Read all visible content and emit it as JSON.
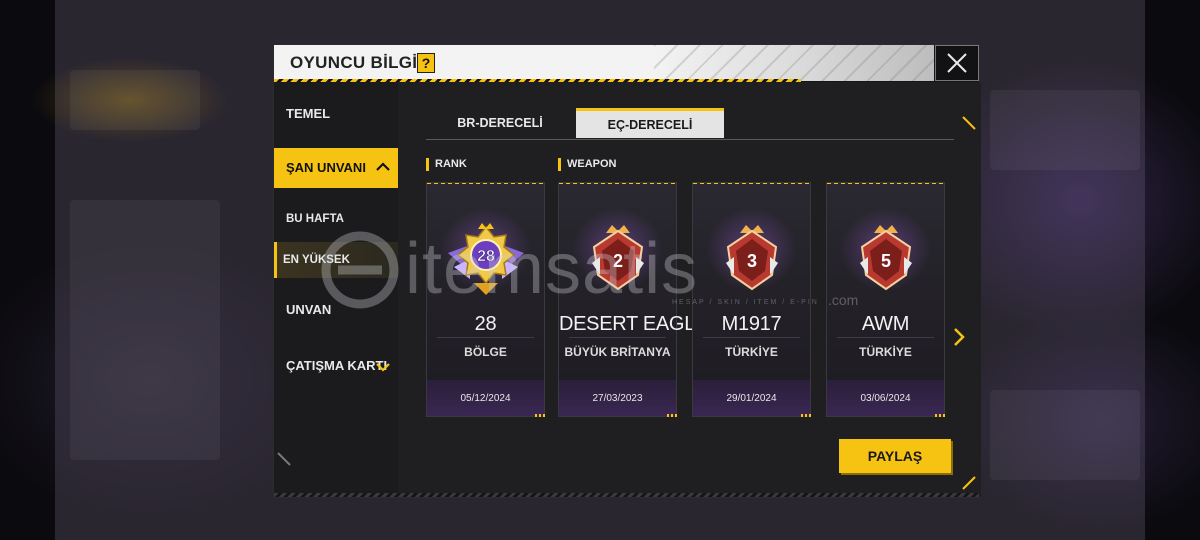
{
  "dialog": {
    "title": "OYUNCU BİLGİSİ",
    "help_icon": "?",
    "close_icon": "close-icon"
  },
  "sidebar": {
    "items": [
      {
        "label": "TEMEL",
        "type": "main"
      },
      {
        "label": "ŞAN UNVANI",
        "type": "main",
        "active": true,
        "icon": "chevron-up-icon"
      },
      {
        "label": "BU HAFTA",
        "type": "sub"
      },
      {
        "label": "EN YÜKSEK",
        "type": "sub",
        "selected": true
      },
      {
        "label": "UNVAN",
        "type": "main"
      },
      {
        "label": "ÇATIŞMA KARTI",
        "type": "main",
        "icon": "chevron-down-icon"
      }
    ]
  },
  "tabs": [
    {
      "label": "BR-DERECELİ",
      "active": false
    },
    {
      "label": "EÇ-DERECELİ",
      "active": true
    }
  ],
  "sections": {
    "rank": "RANK",
    "weapon": "WEAPON"
  },
  "cards": [
    {
      "badge_number": "28",
      "name": "28",
      "region": "BÖLGE",
      "date": "05/12/2024"
    },
    {
      "badge_number": "2",
      "name": "DESERT EAGLE",
      "region": "BÜYÜK BRİTANYA",
      "date": "27/03/2023"
    },
    {
      "badge_number": "3",
      "name": "M1917",
      "region": "TÜRKİYE",
      "date": "29/01/2024"
    },
    {
      "badge_number": "5",
      "name": "AWM",
      "region": "TÜRKİYE",
      "date": "03/06/2024"
    }
  ],
  "share_button": "PAYLAŞ",
  "next_icon": "chevron-right-icon",
  "watermark": {
    "text": "itemsatis",
    "subtext": "HESAP / SKIN / ITEM / E-PIN",
    "suffix": ".com"
  },
  "colors": {
    "accent": "#f6c313",
    "panel": "#151517",
    "card_footer": "#3a2752"
  }
}
